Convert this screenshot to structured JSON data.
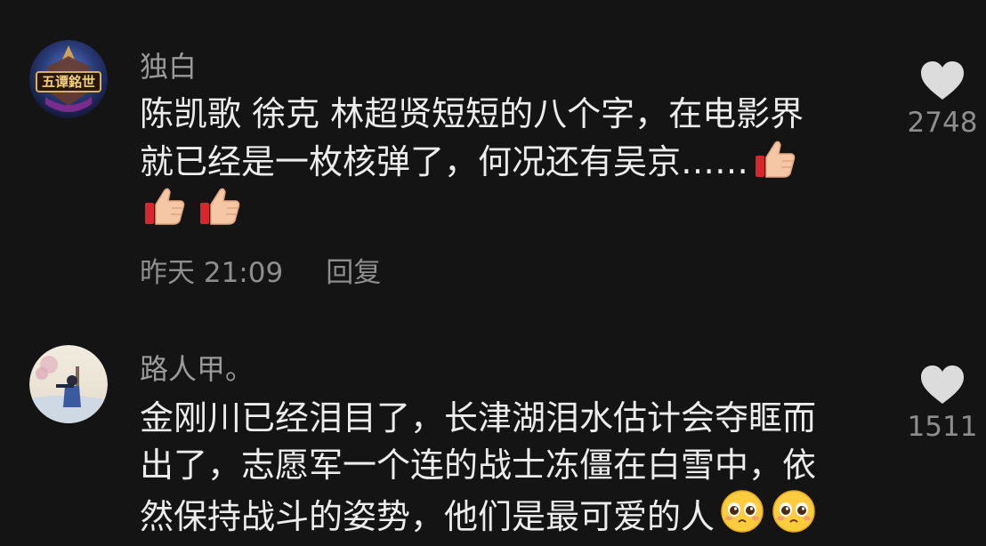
{
  "comments": [
    {
      "username": "独白",
      "avatar_badge": "五谭銘世",
      "lines": [
        "陈凯歌 徐克 林超贤短短的八个字，在电影界",
        "就已经是一枚核弹了，何况还有吴京……",
        ""
      ],
      "emojis": [
        "thumbs-up",
        "thumbs-up",
        "thumbs-up"
      ],
      "timestamp": "昨天 21:09",
      "reply_label": "回复",
      "like_count": "2748"
    },
    {
      "username": "路人甲。",
      "lines": [
        "金刚川已经泪目了，长津湖泪水估计会夺眶而",
        "出了，志愿军一个连的战士冻僵在白雪中，依",
        "然保持战斗的姿势，他们是最可爱的人"
      ],
      "emojis": [
        "pleading-face",
        "pleading-face"
      ],
      "like_count": "1511"
    }
  ],
  "colors": {
    "background": "#141414",
    "text": "#ececec",
    "secondary_text": "#9a9a9a",
    "heart": "#dcdcdc"
  }
}
